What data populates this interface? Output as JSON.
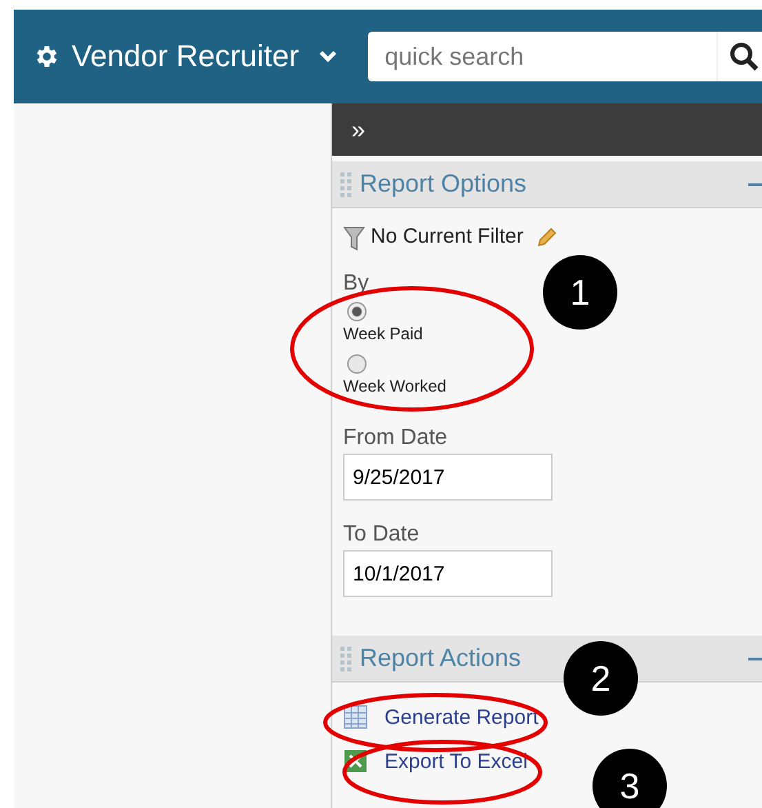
{
  "header": {
    "title": "Vendor Recruiter",
    "search": {
      "placeholder": "quick search"
    }
  },
  "panel_toggle": "»",
  "report_options": {
    "title": "Report Options",
    "filter": "No Current Filter",
    "by_label": "By",
    "options": [
      {
        "label": "Week Paid",
        "selected": true
      },
      {
        "label": "Week Worked",
        "selected": false
      }
    ],
    "from_date": {
      "label": "From Date",
      "value": "9/25/2017"
    },
    "to_date": {
      "label": "To Date",
      "value": "10/1/2017"
    }
  },
  "report_actions": {
    "title": "Report Actions",
    "actions": [
      {
        "label": "Generate Report",
        "kind": "report"
      },
      {
        "label": "Export To Excel",
        "kind": "excel"
      }
    ]
  },
  "annotations": [
    "1",
    "2",
    "3"
  ]
}
